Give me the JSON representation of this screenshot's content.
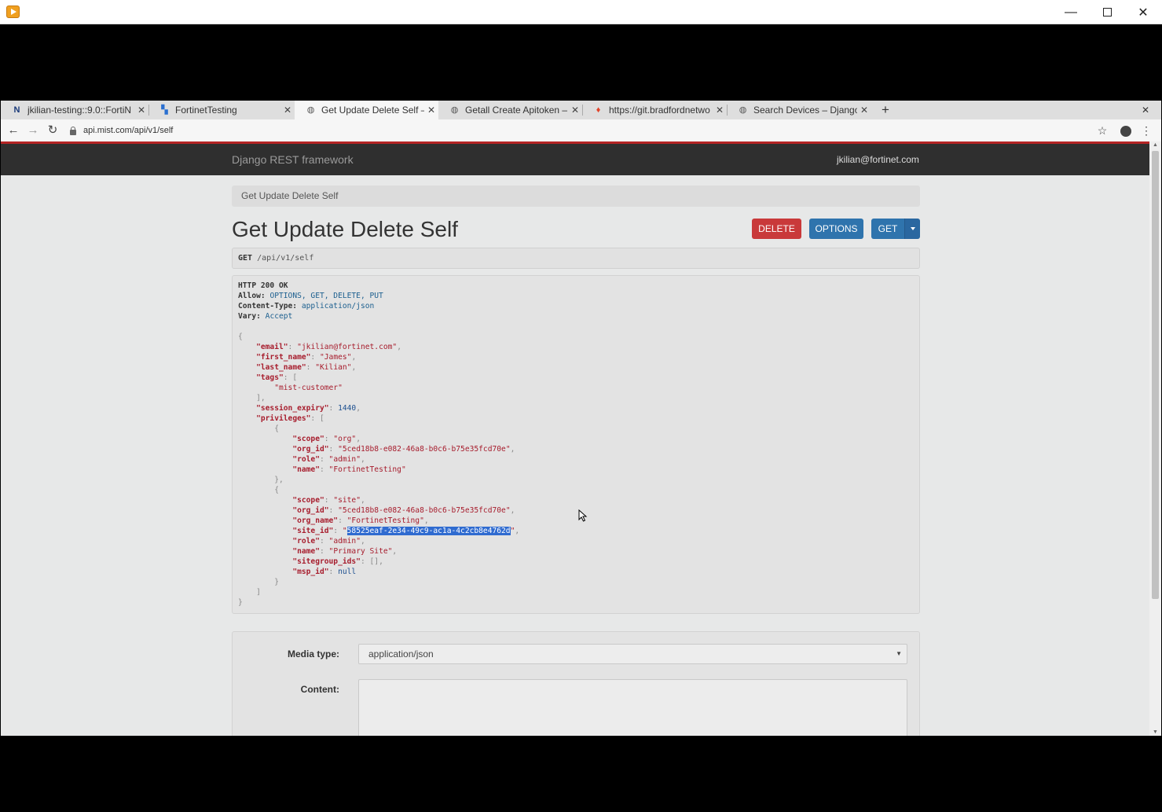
{
  "window": {
    "min_glyph": "—",
    "close_glyph": "✕"
  },
  "tabs": [
    {
      "title": "jkilian-testing::9.0::FortiN",
      "icon": "netbox-icon"
    },
    {
      "title": "FortinetTesting",
      "icon": "dashboard-icon"
    },
    {
      "title": "Get Update Delete Self – I",
      "icon": "globe-icon"
    },
    {
      "title": "Getall Create Apitoken – D",
      "icon": "globe-icon"
    },
    {
      "title": "https://git.bradfordnetwo",
      "icon": "gitlab-icon"
    },
    {
      "title": "Search Devices – Django I",
      "icon": "globe-icon"
    }
  ],
  "address": {
    "url": "api.mist.com/api/v1/self"
  },
  "navbar": {
    "brand": "Django REST framework",
    "user": "jkilian@fortinet.com"
  },
  "breadcrumb": "Get Update Delete Self",
  "heading": "Get Update Delete Self",
  "buttons": {
    "delete": "DELETE",
    "options": "OPTIONS",
    "get": "GET"
  },
  "request": {
    "method": "GET",
    "path": "/api/v1/self"
  },
  "response": {
    "status": "HTTP 200 OK",
    "headers": [
      {
        "name": "Allow:",
        "value": "OPTIONS, GET, DELETE, PUT"
      },
      {
        "name": "Content-Type:",
        "value": "application/json"
      },
      {
        "name": "Vary:",
        "value": "Accept"
      }
    ],
    "body": {
      "email": "jkilian@fortinet.com",
      "first_name": "James",
      "last_name": "Kilian",
      "tags": [
        "mist-customer"
      ],
      "session_expiry": 1440,
      "privileges": [
        {
          "scope": "org",
          "org_id": "5ced18b8-e082-46a8-b0c6-b75e35fcd70e",
          "role": "admin",
          "name": "FortinetTesting"
        },
        {
          "scope": "site",
          "org_id": "5ced18b8-e082-46a8-b0c6-b75e35fcd70e",
          "org_name": "FortinetTesting",
          "site_id": "58525eaf-2e34-49c9-ac1a-4c2cb8e4762d",
          "role": "admin",
          "name": "Primary Site",
          "sitegroup_ids": "[]",
          "msp_id": "null"
        }
      ]
    }
  },
  "form": {
    "media_type_label": "Media type:",
    "media_type_value": "application/json",
    "content_label": "Content:"
  }
}
